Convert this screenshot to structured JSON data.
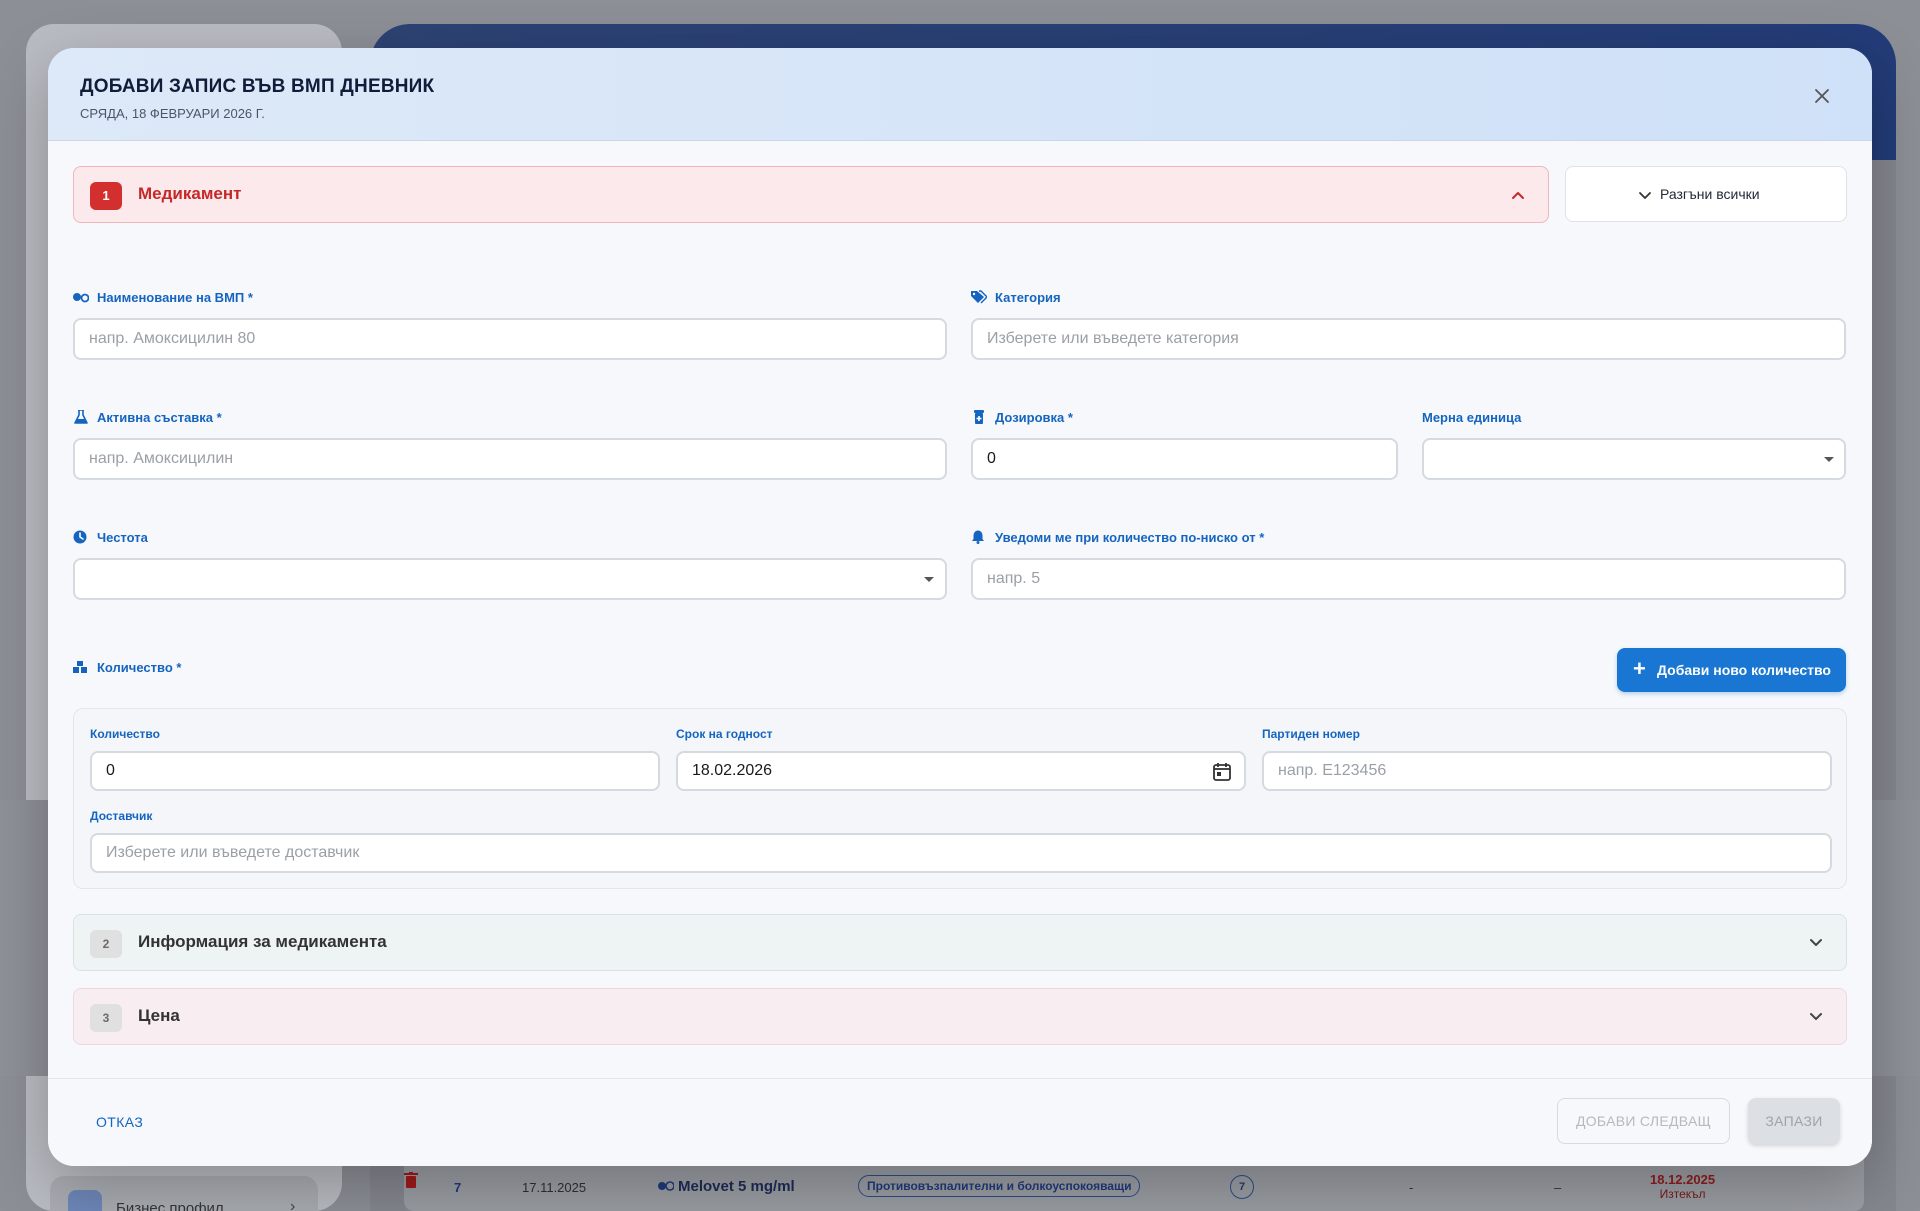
{
  "modal": {
    "title": "ДОБАВИ ЗАПИС ВЪВ ВМП ДНЕВНИК",
    "subtitle": "СРЯДА, 18 ФЕВРУАРИ 2026 Г.",
    "expand_all_label": "Разгъни всички"
  },
  "sections": [
    {
      "number": "1",
      "label": "Медикамент",
      "expanded": true
    },
    {
      "number": "2",
      "label": "Информация за медикамента",
      "expanded": false
    },
    {
      "number": "3",
      "label": "Цена",
      "expanded": false
    }
  ],
  "fields": {
    "name": {
      "label": "Наименование на ВМП *",
      "placeholder": "напр. Амоксицилин 80",
      "value": ""
    },
    "category": {
      "label": "Категория",
      "placeholder": "Изберете или въведете категория",
      "value": ""
    },
    "active_ingredient": {
      "label": "Активна съставка *",
      "placeholder": "напр. Амоксицилин",
      "value": ""
    },
    "dosage": {
      "label": "Дозировка *",
      "value": "0"
    },
    "unit": {
      "label": "Мерна единица",
      "value": ""
    },
    "frequency": {
      "label": "Честота",
      "value": ""
    },
    "notify": {
      "label": "Уведоми ме при количество по-ниско от *",
      "placeholder": "напр. 5",
      "value": ""
    }
  },
  "quantity": {
    "label": "Количество *",
    "add_button_label": "Добави ново количество",
    "qty_label": "Количество",
    "qty_value": "0",
    "expiry_label": "Срок на годност",
    "expiry_value": "18.02.2026",
    "batch_label": "Партиден номер",
    "batch_placeholder": "напр. E123456",
    "supplier_label": "Доставчик",
    "supplier_placeholder": "Изберете или въведете доставчик"
  },
  "footer": {
    "cancel_label": "ОТКАЗ",
    "add_next_label": "ДОБАВИ СЛЕДВАЩ",
    "save_label": "ЗАПАЗИ"
  },
  "background": {
    "business_profile_label": "Бизнес профил",
    "row": {
      "number": "7",
      "date": "17.11.2025",
      "name": "Melovet 5 mg/ml",
      "category": "Противовъзпалителни и болкоуспокояващи",
      "badge": "7",
      "dash1": "-",
      "dash2": "–",
      "expiry_date": "18.12.2025",
      "expiry_status": "Изтекъл"
    }
  },
  "colors": {
    "primary": "#1976d2",
    "section_active": "#c62828",
    "header_bg": "#d6e6f8"
  }
}
